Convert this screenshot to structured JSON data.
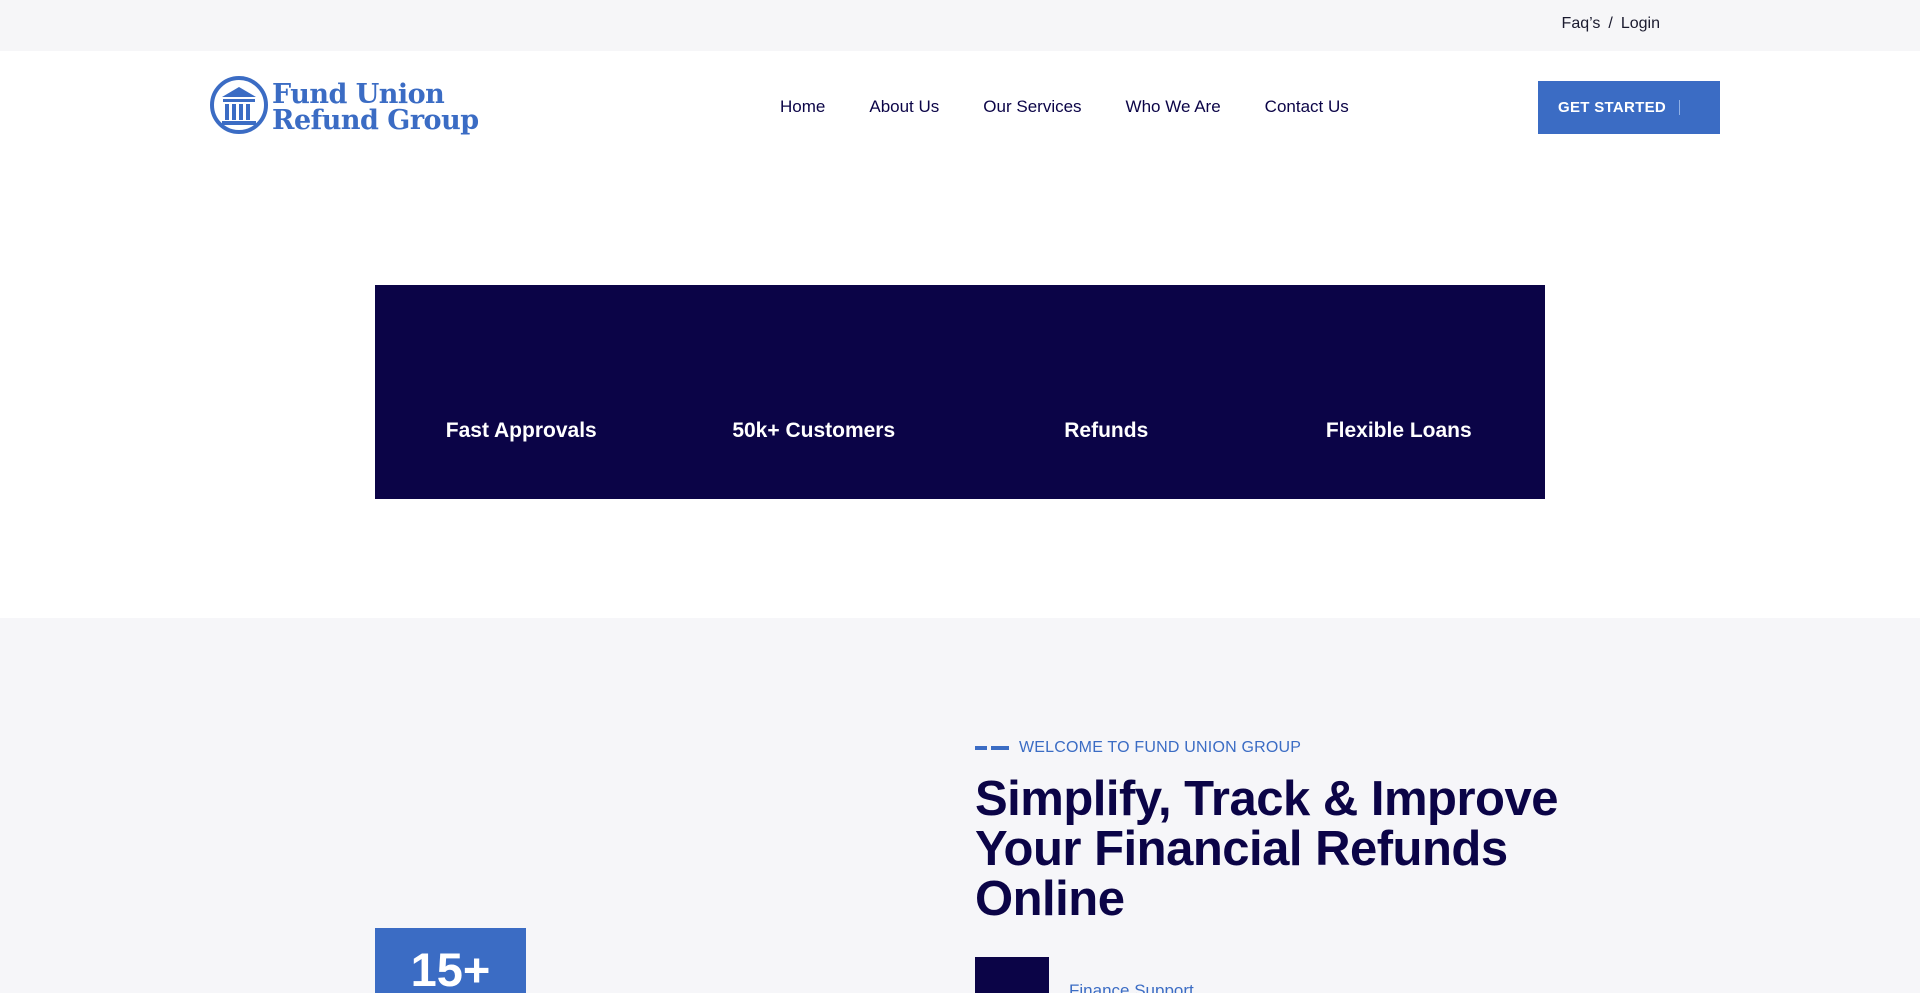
{
  "topbar": {
    "faq_label": "Faq’s",
    "separator": "/",
    "login_label": "Login"
  },
  "header": {
    "logo": {
      "line1": "Fund Union",
      "line2": "Refund Group",
      "icon": "bank-building-icon",
      "brand_color": "#3b6cc4"
    },
    "nav": [
      {
        "label": "Home"
      },
      {
        "label": "About Us"
      },
      {
        "label": "Our Services"
      },
      {
        "label": "Who We Are"
      },
      {
        "label": "Contact Us"
      }
    ],
    "cta_label": "GET STARTED"
  },
  "stats": [
    {
      "label": "Fast Approvals"
    },
    {
      "label": "50k+ Customers"
    },
    {
      "label": "Refunds"
    },
    {
      "label": "Flexible Loans"
    }
  ],
  "about": {
    "eyebrow": "WELCOME TO FUND UNION GROUP",
    "headline": "Simplify, Track & Improve Your Financial Refunds Online",
    "years_value": "15+",
    "feature_label": "Finance Support"
  },
  "colors": {
    "accent": "#3b6cc4",
    "navy": "#0b0447",
    "light_bg": "#f6f6f8"
  }
}
